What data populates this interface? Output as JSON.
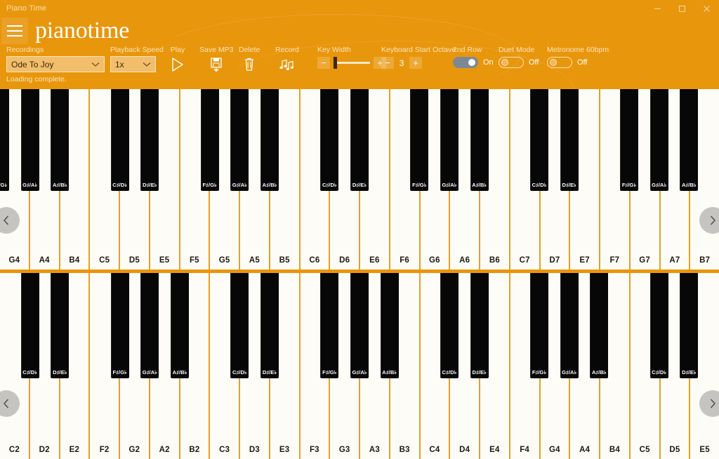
{
  "window": {
    "title": "Piano Time",
    "controls": [
      {
        "name": "minimize",
        "glyph": "minimize-icon"
      },
      {
        "name": "maximize",
        "glyph": "maximize-icon"
      },
      {
        "name": "close",
        "glyph": "close-icon"
      }
    ]
  },
  "header": {
    "menu_icon": "hamburger-menu-icon",
    "logo_text": "pianotime"
  },
  "toolbar": {
    "recordings": {
      "label": "Recordings",
      "value": "Ode To Joy",
      "options": [
        "Ode To Joy"
      ],
      "chevron": "chevron-down-icon"
    },
    "playback_speed": {
      "label": "Playback Speed",
      "value": "1x",
      "options": [
        "1x"
      ],
      "chevron": "chevron-down-icon"
    },
    "play": {
      "label": "Play",
      "icon": "play-triangle-icon"
    },
    "save_mp3": {
      "label": "Save MP3",
      "icon": "floppy-save-icon"
    },
    "delete": {
      "label": "Delete",
      "icon": "trash-can-icon"
    },
    "record": {
      "label": "Record",
      "icon": "music-notes-icon"
    },
    "key_width": {
      "label": "Key Width",
      "minus": "−",
      "plus": "+",
      "slider_percent": 4
    },
    "keyboard_start_octave": {
      "label": "Keyboard Start Octave",
      "minus": "−",
      "plus": "+",
      "value": "3"
    },
    "second_row": {
      "label": "2nd Row",
      "state": "on",
      "state_text": "On"
    },
    "duet_mode": {
      "label": "Duet Mode",
      "state": "off",
      "state_text": "Off"
    },
    "metronome": {
      "label": "Metronome  60bpm",
      "state": "off",
      "state_text": "Off"
    }
  },
  "status": {
    "text": "Loading complete."
  },
  "navigation": {
    "left_icon": "chevron-left-icon",
    "right_icon": "chevron-right-icon"
  },
  "keyboards": [
    {
      "id": "top",
      "white_keys": [
        "G4",
        "A4",
        "B4",
        "C5",
        "D5",
        "E5",
        "F5",
        "G5",
        "A5",
        "B5",
        "C6",
        "D6",
        "E6",
        "F6",
        "G6",
        "A6",
        "B6",
        "C7",
        "D7",
        "E7",
        "F7",
        "G7",
        "A7",
        "B7"
      ],
      "black_keys": [
        {
          "label": "F♯/G♭",
          "after": -1
        },
        {
          "label": "G♯/A♭",
          "after": 0
        },
        {
          "label": "A♯/B♭",
          "after": 1
        },
        {
          "label": "C♯/D♭",
          "after": 3
        },
        {
          "label": "D♯/E♭",
          "after": 4
        },
        {
          "label": "F♯/G♭",
          "after": 6
        },
        {
          "label": "G♯/A♭",
          "after": 7
        },
        {
          "label": "A♯/B♭",
          "after": 8
        },
        {
          "label": "C♯/D♭",
          "after": 10
        },
        {
          "label": "D♯/E♭",
          "after": 11
        },
        {
          "label": "F♯/G♭",
          "after": 13
        },
        {
          "label": "G♯/A♭",
          "after": 14
        },
        {
          "label": "A♯/B♭",
          "after": 15
        },
        {
          "label": "C♯/D♭",
          "after": 17
        },
        {
          "label": "D♯/E♭",
          "after": 18
        },
        {
          "label": "F♯/G♭",
          "after": 20
        },
        {
          "label": "G♯/A♭",
          "after": 21
        },
        {
          "label": "A♯/B♭",
          "after": 22
        }
      ],
      "black_height": 145
    },
    {
      "id": "bottom",
      "white_keys": [
        "C2",
        "D2",
        "E2",
        "F2",
        "G2",
        "A2",
        "B2",
        "C3",
        "D3",
        "E3",
        "F3",
        "G3",
        "A3",
        "B3",
        "C4",
        "D4",
        "E4",
        "F4",
        "G4",
        "A4",
        "B4",
        "C5",
        "D5",
        "E5"
      ],
      "black_keys": [
        {
          "label": "C♯/D♭",
          "after": 0
        },
        {
          "label": "D♯/E♭",
          "after": 1
        },
        {
          "label": "F♯/G♭",
          "after": 3
        },
        {
          "label": "G♯/A♭",
          "after": 4
        },
        {
          "label": "A♯/B♭",
          "after": 5
        },
        {
          "label": "C♯/D♭",
          "after": 7
        },
        {
          "label": "D♯/E♭",
          "after": 8
        },
        {
          "label": "F♯/G♭",
          "after": 10
        },
        {
          "label": "G♯/A♭",
          "after": 11
        },
        {
          "label": "A♯/B♭",
          "after": 12
        },
        {
          "label": "C♯/D♭",
          "after": 14
        },
        {
          "label": "D♯/E♭",
          "after": 15
        },
        {
          "label": "F♯/G♭",
          "after": 17
        },
        {
          "label": "G♯/A♭",
          "after": 18
        },
        {
          "label": "A♯/B♭",
          "after": 19
        },
        {
          "label": "C♯/D♭",
          "after": 21
        },
        {
          "label": "D♯/E♭",
          "after": 22
        }
      ],
      "black_height": 150
    }
  ],
  "colors": {
    "brand_orange": "#E8960C",
    "key_divider": "#E0A22A",
    "white_key": "#FDFCF7",
    "black_key": "#070707",
    "toggle_on": "#7D8894"
  }
}
